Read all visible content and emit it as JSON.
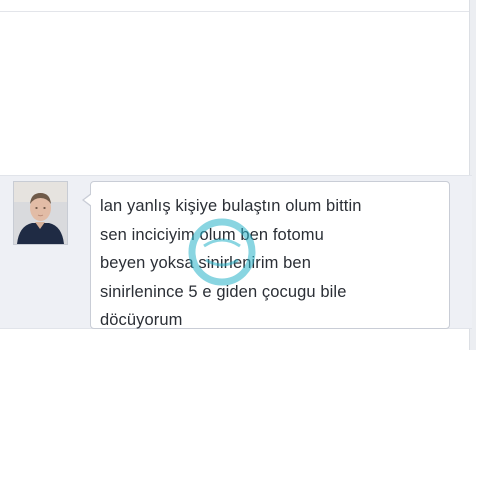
{
  "chat": {
    "message_lines": [
      "lan yanlış kişiye bulaştın olum bittin",
      "sen inciciyim olum ben fotomu",
      "beyen yoksa sinirlenirim ben",
      "sinirlenince 5 e giden çocugu bile",
      "döcüyorum"
    ]
  },
  "colors": {
    "strip_background": "#eef0f5",
    "bubble_border": "#c9cdd6",
    "watermark": "#2ab3c9"
  },
  "icons": {
    "avatar": "profile-photo",
    "watermark": "watermark-logo"
  }
}
